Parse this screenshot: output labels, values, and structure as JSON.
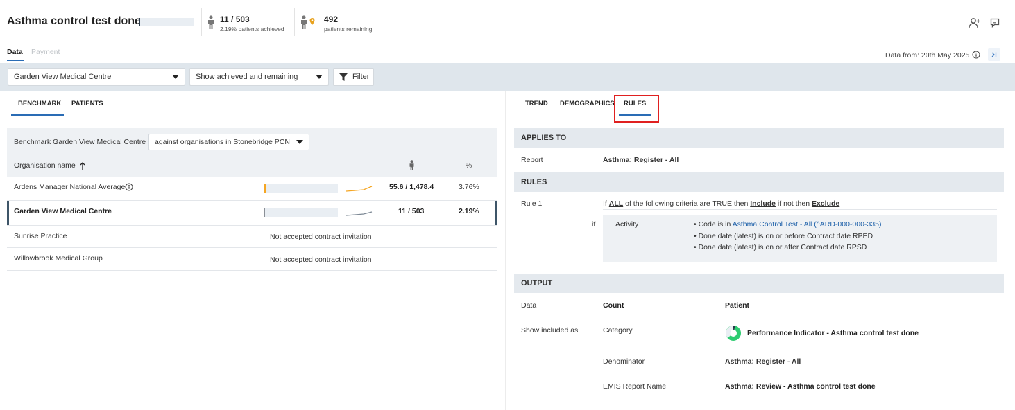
{
  "header": {
    "title": "Asthma control test done",
    "achieved_count": "11 / 503",
    "achieved_label": "2.19% patients achieved",
    "remaining_count": "492",
    "remaining_label": "patients remaining"
  },
  "progress": {
    "achieved_fraction": 0.0219
  },
  "tabs": {
    "data": "Data",
    "payment": "Payment"
  },
  "data_from": "Data from: 20th May 2025",
  "filters": {
    "practice": "Garden View Medical Centre",
    "show": "Show achieved and remaining",
    "filter_label": "Filter"
  },
  "left": {
    "subtabs": {
      "benchmark": "BENCHMARK",
      "patients": "PATIENTS"
    },
    "benchmark_label": "Benchmark Garden View Medical Centre",
    "benchmark_select": "against organisations in Stonebridge PCN",
    "col_org": "Organisation name",
    "col_pct": "%",
    "rows": [
      {
        "name": "Ardens Manager National Average",
        "value": "55.6 / 1,478.4",
        "pct": "3.76%",
        "fraction": 0.0376,
        "color": "#f5a623"
      },
      {
        "name": "Garden View Medical Centre",
        "value": "11 / 503",
        "pct": "2.19%",
        "fraction": 0.0219,
        "color": "#8a8f96"
      },
      {
        "name": "Sunrise Practice",
        "note": "Not accepted contract invitation"
      },
      {
        "name": "Willowbrook Medical Group",
        "note": "Not accepted contract invitation"
      }
    ]
  },
  "right": {
    "subtabs": {
      "trend": "TREND",
      "demographics": "DEMOGRAPHICS",
      "rules": "RULES"
    },
    "applies_to": {
      "heading": "APPLIES TO",
      "label": "Report",
      "value": "Asthma: Register - All"
    },
    "rules": {
      "heading": "RULES",
      "rule_label": "Rule 1",
      "sentence": {
        "p1": "If ",
        "all": "ALL",
        "p2": " of the following criteria are TRUE then ",
        "include": "Include",
        "p3": " if not then ",
        "exclude": "Exclude"
      },
      "if_label": "if",
      "criteria_type": "Activity",
      "criteria": {
        "code_prefix": "Code is in ",
        "code_link": "Asthma Control Test - All (^ARD-000-000-335)",
        "line2": "Done date (latest) is on or before Contract date RPED",
        "line3": "Done date (latest) is on or after Contract date RPSD"
      }
    },
    "output": {
      "heading": "OUTPUT",
      "data_label": "Data",
      "data_type": "Count",
      "data_value": "Patient",
      "show_label": "Show included as",
      "show_type": "Category",
      "show_value": "Performance Indicator - Asthma control test done",
      "denominator_label": "Denominator",
      "denominator_value": "Asthma: Register - All",
      "emis_label": "EMIS Report Name",
      "emis_value": "Asthma: Review - Asthma control test done"
    }
  },
  "colors": {
    "accent": "#2a6cb5",
    "highlight": "#e02020",
    "orange": "#f5a623",
    "green": "#2ecc71"
  }
}
